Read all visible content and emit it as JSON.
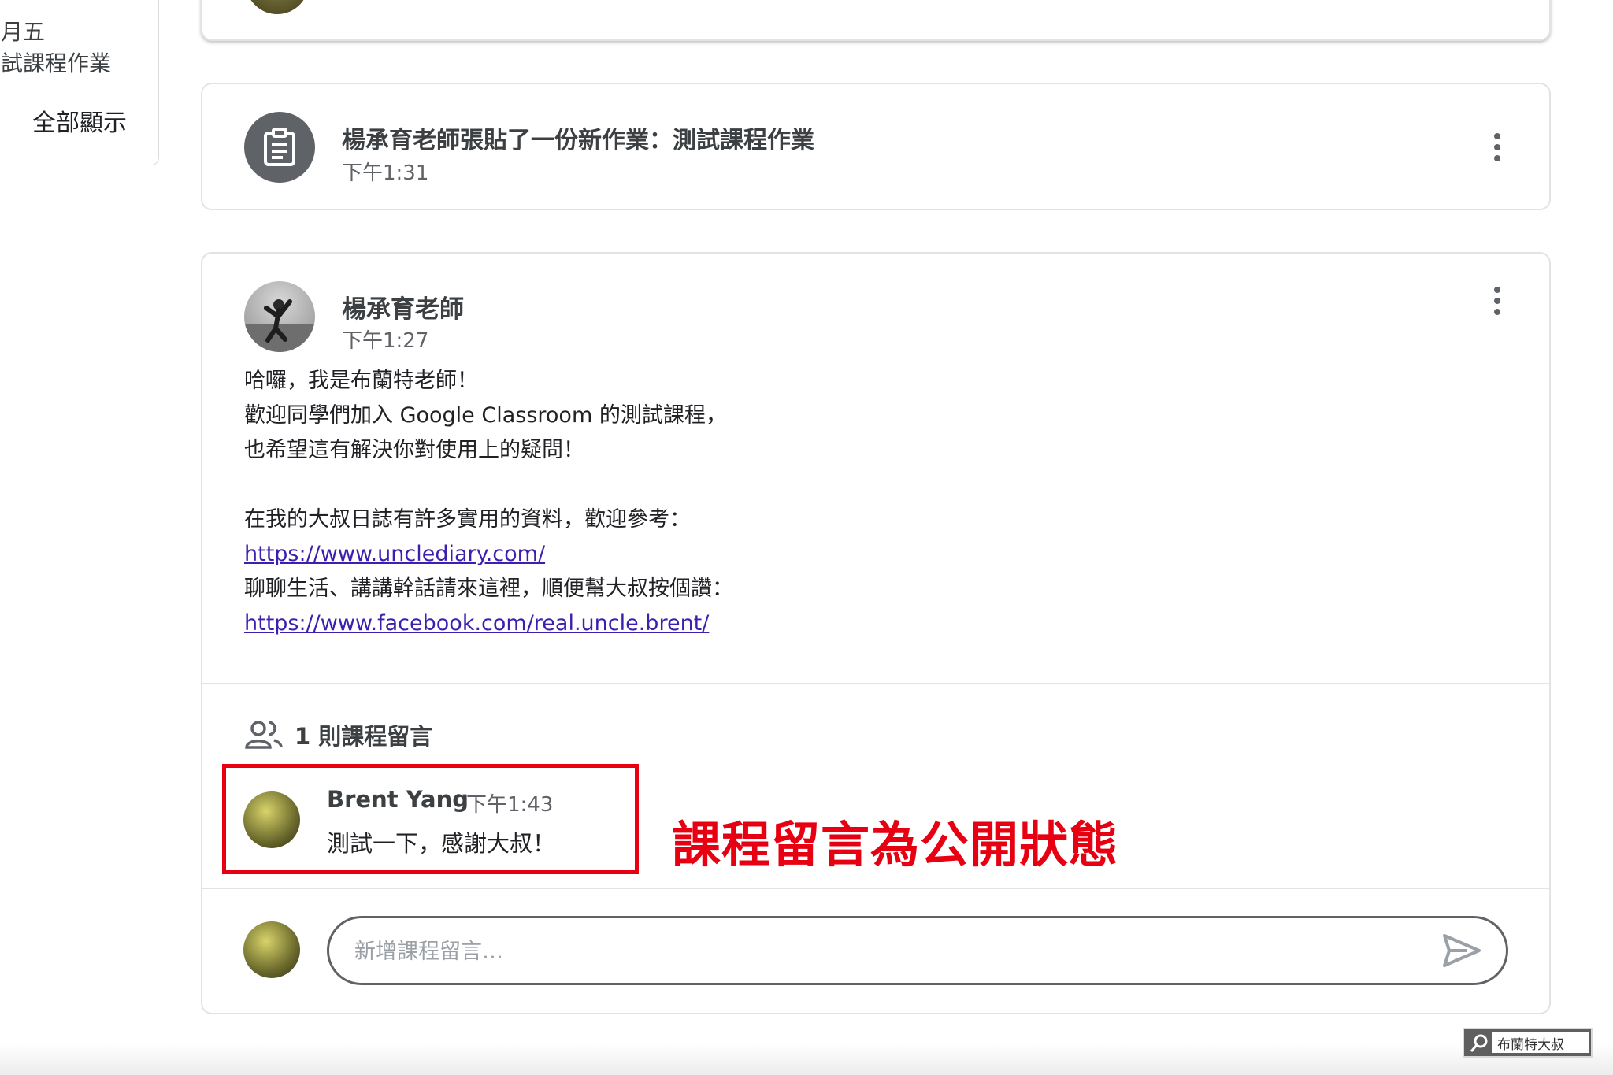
{
  "sidebar": {
    "line1": "月五",
    "line2": "試課程作業",
    "show_all": "全部顯示"
  },
  "assignment": {
    "title": "楊承育老師張貼了一份新作業：測試課程作業",
    "time": "下午1:31"
  },
  "post": {
    "author": "楊承育老師",
    "time": "下午1:27",
    "lines": [
      "哈囉，我是布蘭特老師！",
      "歡迎同學們加入 Google Classroom 的測試課程，",
      "也希望這有解決你對使用上的疑問！",
      "在我的大叔日誌有許多實用的資料，歡迎參考：",
      "https://www.unclediary.com/",
      "聊聊生活、講講幹話請來這裡，順便幫大叔按個讚：",
      "https://www.facebook.com/real.uncle.brent/"
    ]
  },
  "comments": {
    "count_label": "1 則課程留言",
    "items": [
      {
        "author": "Brent Yang",
        "time": "下午1:43",
        "text": "測試一下，感謝大叔！"
      }
    ],
    "input_placeholder": "新增課程留言…"
  },
  "annotation": "課程留言為公開狀態",
  "watermark": "布蘭特大叔",
  "colors": {
    "annotation_red": "#e60012",
    "link": "#3c1fb0",
    "icon_gray": "#5f6368"
  },
  "icons": [
    "assignment-icon",
    "more-vert-icon",
    "people-icon",
    "send-icon",
    "search-icon"
  ]
}
